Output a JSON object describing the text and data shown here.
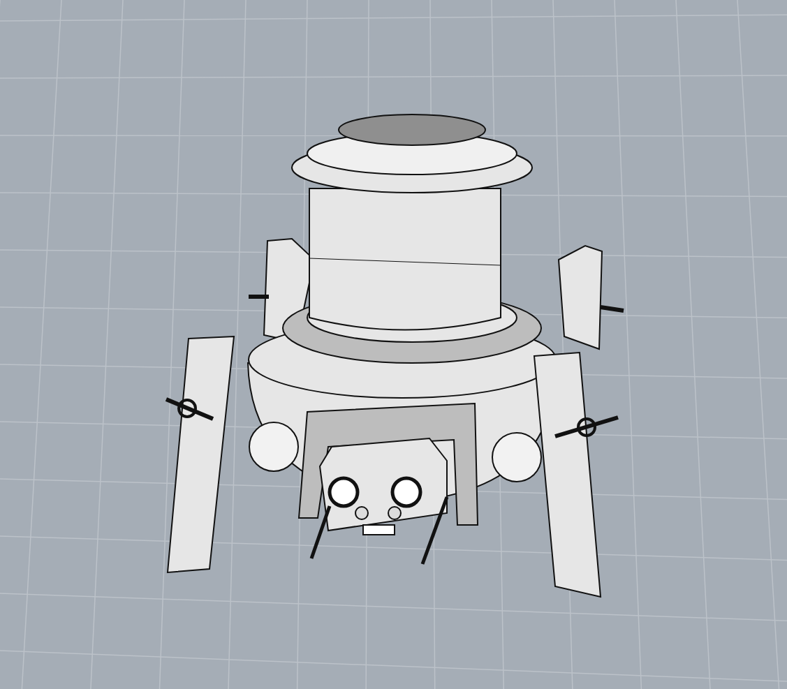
{
  "viewport": {
    "kind": "perspective",
    "grid": true
  }
}
